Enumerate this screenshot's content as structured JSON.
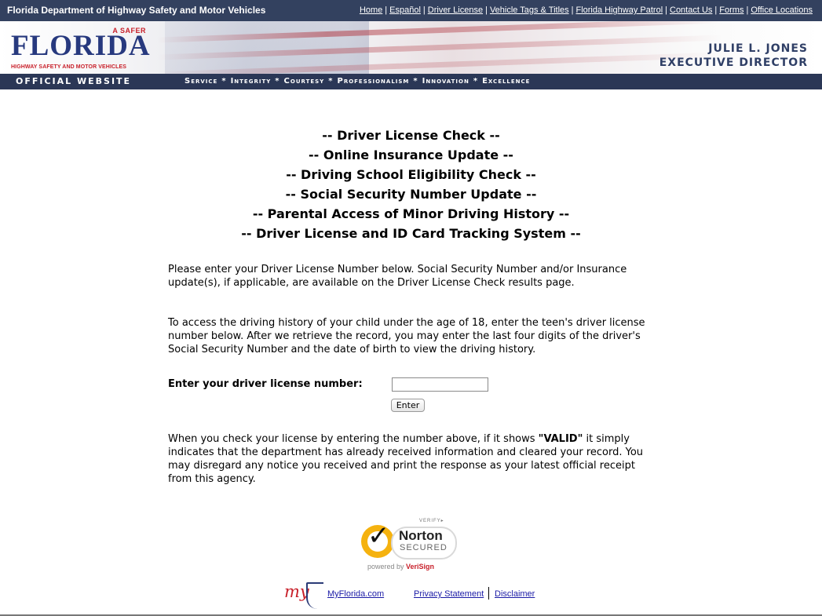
{
  "header": {
    "department": "Florida Department of Highway Safety and Motor Vehicles",
    "nav": [
      "Home",
      "Español",
      "Driver License",
      "Vehicle Tags & Titles",
      "Florida Highway Patrol",
      "Contact Us",
      "Forms",
      "Office Locations"
    ]
  },
  "banner": {
    "logo_asafer": "A SAFER",
    "logo_word": "FLORIDA",
    "logo_tagline": "HIGHWAY SAFETY AND MOTOR VEHICLES",
    "director_name": "JULIE L. JONES",
    "director_title": "EXECUTIVE DIRECTOR"
  },
  "valuesbar": {
    "official": "OFFICIAL WEBSITE",
    "values": [
      "Service",
      "Integrity",
      "Courtesy",
      "Professionalism",
      "Innovation",
      "Excellence"
    ]
  },
  "headings": [
    "-- Driver License Check --",
    "-- Online Insurance Update --",
    "-- Driving School Eligibility Check --",
    "-- Social Security Number Update --",
    "-- Parental Access of Minor Driving History --",
    "-- Driver License and ID Card Tracking System --"
  ],
  "content": {
    "intro": "Please enter your Driver License Number below. Social Security Number and/or Insurance update(s), if applicable, are available on the Driver License Check results page.",
    "parental": "To access the driving history of your child under the age of 18, enter the teen's driver license number below. After we retrieve the record, you may enter the last four digits of the driver's Social Security Number and the date of birth to view the driving history.",
    "form_label": "Enter your driver license number:",
    "input_value": "",
    "enter_button": "Enter",
    "valid_pre": "When you check your license by entering the number above, if it shows ",
    "valid_word": "\"VALID\"",
    "valid_post": " it simply indicates that the department has already received information and cleared your record. You may disregard any notice you received and print the response as your latest official receipt from this agency."
  },
  "norton": {
    "verify": "VERIFY▸",
    "name": "Norton",
    "secured": "SECURED",
    "powered_by": "powered by ",
    "verisign": "VeriSign"
  },
  "footer": {
    "myflorida_logo": "my",
    "links": [
      "MyFlorida.com",
      "Privacy Statement",
      "Disclaimer"
    ]
  },
  "colors": {
    "navy": "#33415f",
    "banner_blue": "#27397e",
    "accent_red": "#c8202a",
    "link": "#1a1aa6"
  }
}
